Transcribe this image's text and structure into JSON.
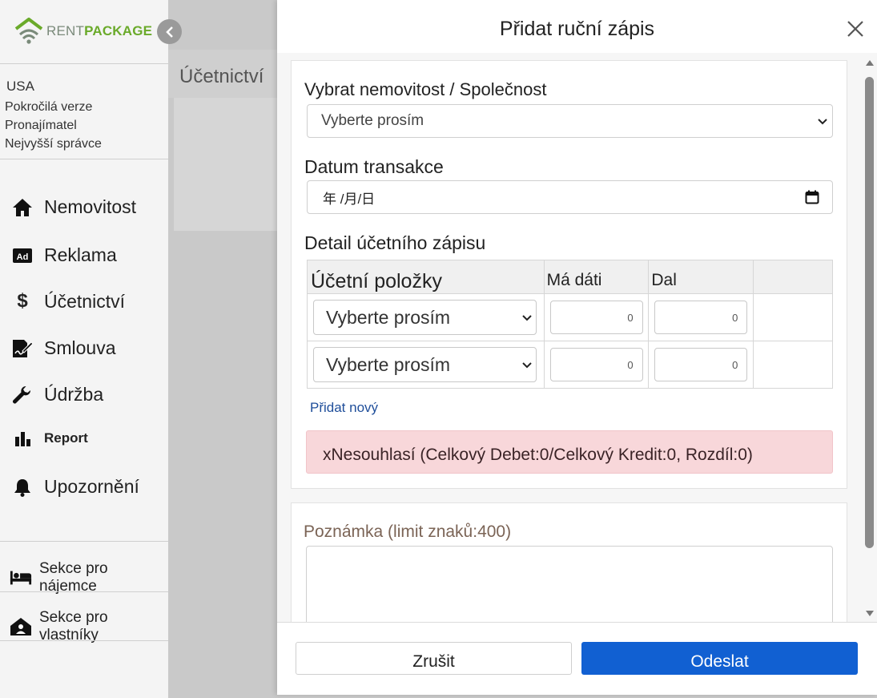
{
  "app": {
    "logo_text_rent": "RENT",
    "logo_text_package": "PACKAGE"
  },
  "sidebar": {
    "country": "USA",
    "account_lines": [
      "Pokročilá verze",
      "Pronajímatel",
      "Nejvyšší správce"
    ],
    "items": [
      {
        "label": "Nemovitost",
        "icon": "home-icon"
      },
      {
        "label": "Reklama",
        "icon": "ad-icon"
      },
      {
        "label": "Účetnictví",
        "icon": "dollar-icon"
      },
      {
        "label": "Smlouva",
        "icon": "contract-icon"
      },
      {
        "label": "Údržba",
        "icon": "wrench-icon"
      },
      {
        "label": "Report",
        "icon": "bar-chart-icon"
      },
      {
        "label": "Upozornění",
        "icon": "bell-icon"
      }
    ],
    "sections": [
      {
        "label": "Sekce pro nájemce",
        "icon": "bed-icon"
      },
      {
        "label": "Sekce pro vlastníky",
        "icon": "house-owner-icon"
      }
    ]
  },
  "page": {
    "title": "Účetnictví"
  },
  "modal": {
    "title": "Přidat ruční zápis",
    "property_label": "Vybrat nemovitost / Společnost",
    "property_value": "Vyberte prosím",
    "date_label": "Datum transakce",
    "date_placeholder": "年 /月/日",
    "detail_label": "Detail účetního zápisu",
    "table": {
      "headers": [
        "Účetní položky",
        "Má dáti",
        "Dal",
        ""
      ],
      "rows": [
        {
          "account": "Vyberte prosím",
          "debit": "0",
          "credit": "0"
        },
        {
          "account": "Vyberte prosím",
          "debit": "0",
          "credit": "0"
        }
      ]
    },
    "add_new": "Přidat nový",
    "alert": "xNesouhlasí (Celkový Debet:0/Celkový Kredit:0, Rozdíl:0)",
    "note_label": "Poznámka (limit znaků:400)",
    "cancel_label": "Zrušit",
    "submit_label": "Odeslat"
  },
  "colors": {
    "primary": "#1160d2",
    "alert_bg": "#f8d7da",
    "logo_green": "#6aaa2a"
  }
}
